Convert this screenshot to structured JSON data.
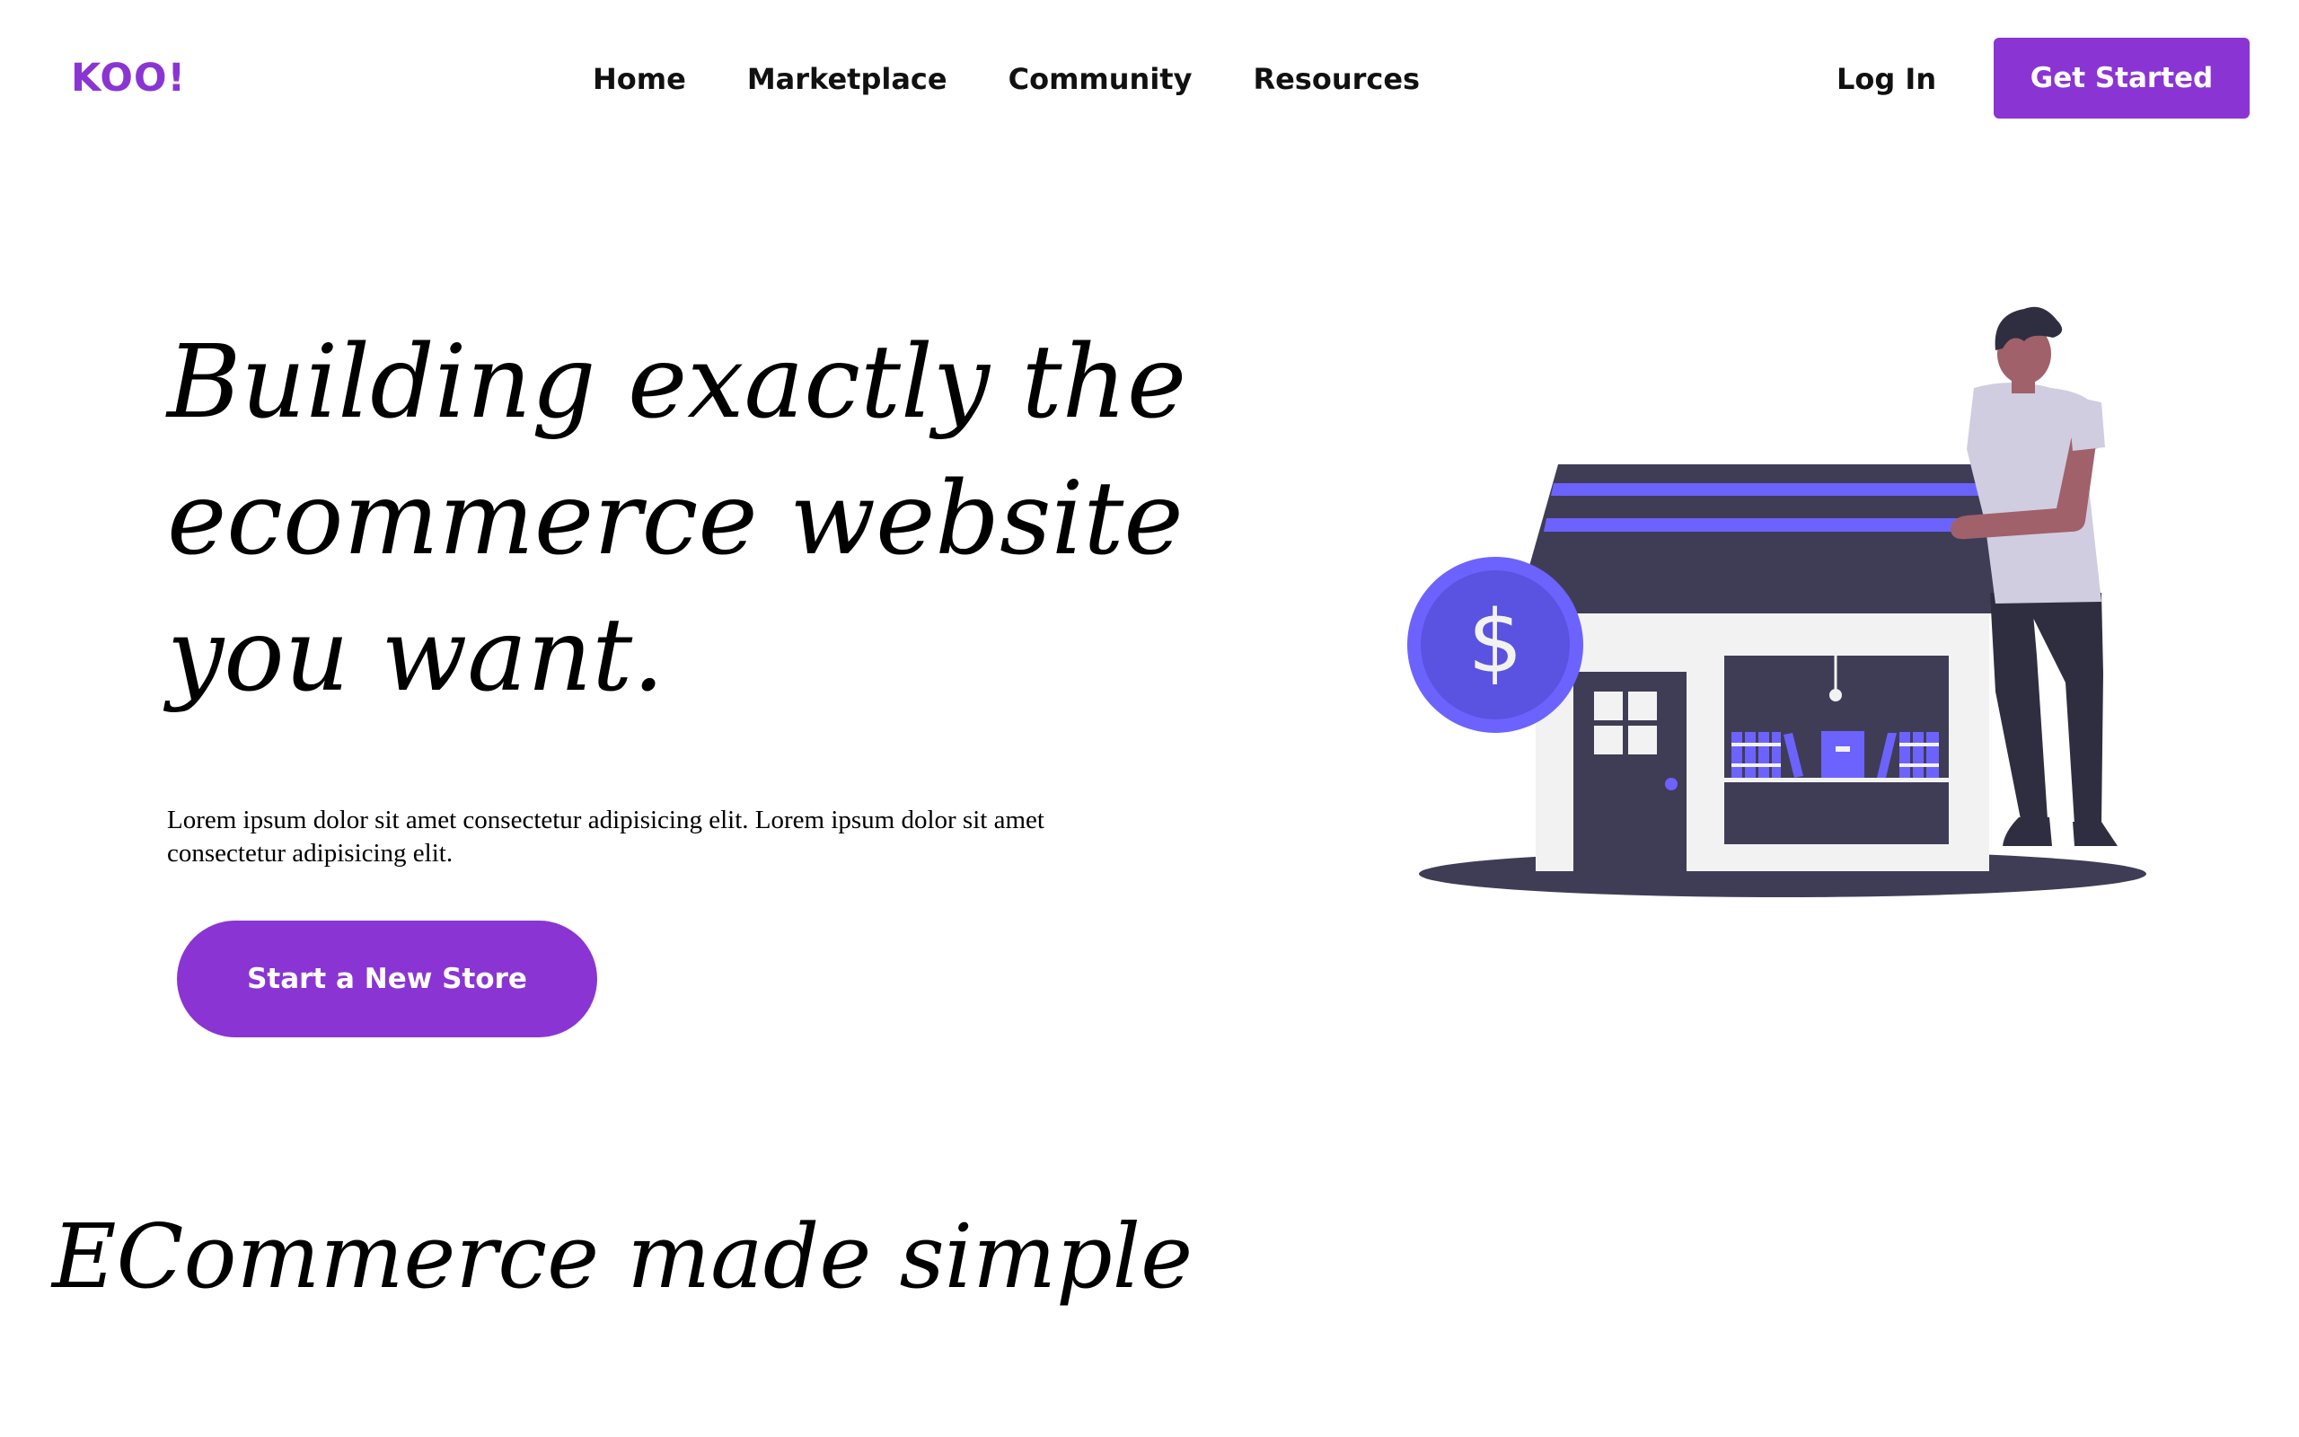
{
  "nav": {
    "logo": "KOO!",
    "links": [
      {
        "label": "Home"
      },
      {
        "label": "Marketplace"
      },
      {
        "label": "Community"
      },
      {
        "label": "Resources"
      }
    ],
    "login": "Log In",
    "cta": "Get Started"
  },
  "hero": {
    "title": "Building exactly the ecommerce website you want.",
    "text": "Lorem ipsum dolor sit amet consectetur adipisicing elit. Lorem ipsum dolor sit amet consectetur adipisicing elit.",
    "button": "Start a New Store",
    "coin_symbol": "$"
  },
  "section": {
    "title": "ECommerce made simple"
  },
  "colors": {
    "brand": "#8a35d3",
    "accent": "#6c63ff",
    "dark": "#3f3d56"
  }
}
